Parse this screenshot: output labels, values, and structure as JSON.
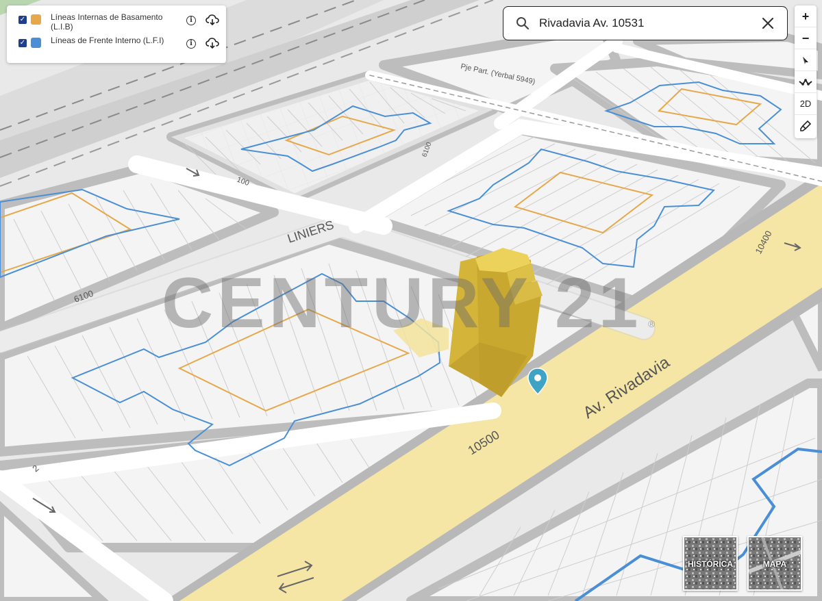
{
  "layers": [
    {
      "label": "Líneas Internas de Basamento (L.I.B)",
      "color": "#e6a84a",
      "checked": true
    },
    {
      "label": "Líneas de Frente Interno (L.F.I)",
      "color": "#4a8fd6",
      "checked": true
    }
  ],
  "search": {
    "value": "Rivadavia Av. 10531",
    "placeholder": ""
  },
  "toolbar": {
    "zoom_in": "+",
    "zoom_out": "−",
    "view_2d": "2D"
  },
  "map_labels": {
    "street_rivadavia": "Av. Rivadavia",
    "street_liniers": "LINIERS",
    "rail_label": "Pje Part. (Yerbal 5949)",
    "num_10500": "10500",
    "num_10400": "10400",
    "num_6100_left": "6100",
    "num_6100_top": "6100",
    "num_100": "100",
    "num_2": "2"
  },
  "watermark": "CENTURY 21",
  "basemaps": [
    {
      "label": "HISTÓRICA"
    },
    {
      "label": "MAPA"
    }
  ],
  "colors": {
    "lib": "#e6a84a",
    "lfi": "#4a8fd6",
    "building": "#e2c33a",
    "avenue": "#f6e6a6"
  }
}
